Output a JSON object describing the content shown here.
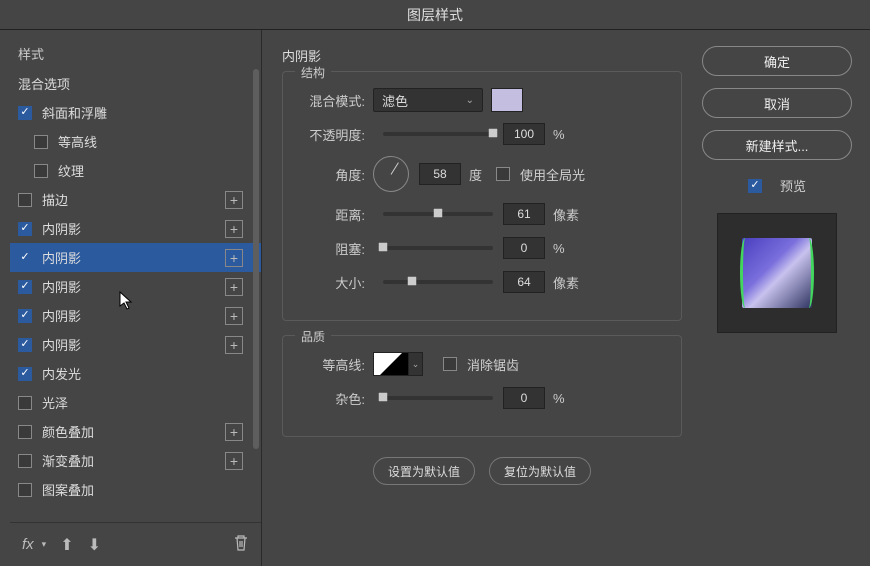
{
  "title": "图层样式",
  "sidebar": {
    "header": "样式",
    "blending_options": "混合选项",
    "items": [
      {
        "label": "斜面和浮雕",
        "checked": true,
        "addable": false,
        "indent": false
      },
      {
        "label": "等高线",
        "checked": false,
        "addable": false,
        "indent": true
      },
      {
        "label": "纹理",
        "checked": false,
        "addable": false,
        "indent": true
      },
      {
        "label": "描边",
        "checked": false,
        "addable": true,
        "indent": false
      },
      {
        "label": "内阴影",
        "checked": true,
        "addable": true,
        "indent": false
      },
      {
        "label": "内阴影",
        "checked": true,
        "addable": true,
        "indent": false,
        "selected": true
      },
      {
        "label": "内阴影",
        "checked": true,
        "addable": true,
        "indent": false
      },
      {
        "label": "内阴影",
        "checked": true,
        "addable": true,
        "indent": false
      },
      {
        "label": "内阴影",
        "checked": true,
        "addable": true,
        "indent": false
      },
      {
        "label": "内发光",
        "checked": true,
        "addable": false,
        "indent": false
      },
      {
        "label": "光泽",
        "checked": false,
        "addable": false,
        "indent": false
      },
      {
        "label": "颜色叠加",
        "checked": false,
        "addable": true,
        "indent": false
      },
      {
        "label": "渐变叠加",
        "checked": false,
        "addable": true,
        "indent": false
      },
      {
        "label": "图案叠加",
        "checked": false,
        "addable": false,
        "indent": false
      }
    ],
    "fx_label": "fx"
  },
  "center": {
    "panel_title": "内阴影",
    "structure": {
      "legend": "结构",
      "blend_mode_label": "混合模式:",
      "blend_mode_value": "滤色",
      "color": "#c4bfe0",
      "opacity_label": "不透明度:",
      "opacity_value": "100",
      "opacity_unit": "%",
      "angle_label": "角度:",
      "angle_value": "58",
      "angle_unit": "度",
      "global_light_label": "使用全局光",
      "global_light_checked": false,
      "distance_label": "距离:",
      "distance_value": "61",
      "distance_unit": "像素",
      "choke_label": "阻塞:",
      "choke_value": "0",
      "choke_unit": "%",
      "size_label": "大小:",
      "size_value": "64",
      "size_unit": "像素"
    },
    "quality": {
      "legend": "品质",
      "contour_label": "等高线:",
      "antialias_label": "消除锯齿",
      "antialias_checked": false,
      "noise_label": "杂色:",
      "noise_value": "0",
      "noise_unit": "%"
    },
    "make_default": "设置为默认值",
    "reset_default": "复位为默认值"
  },
  "right": {
    "ok": "确定",
    "cancel": "取消",
    "new_style": "新建样式...",
    "preview_label": "预览",
    "preview_checked": true
  }
}
